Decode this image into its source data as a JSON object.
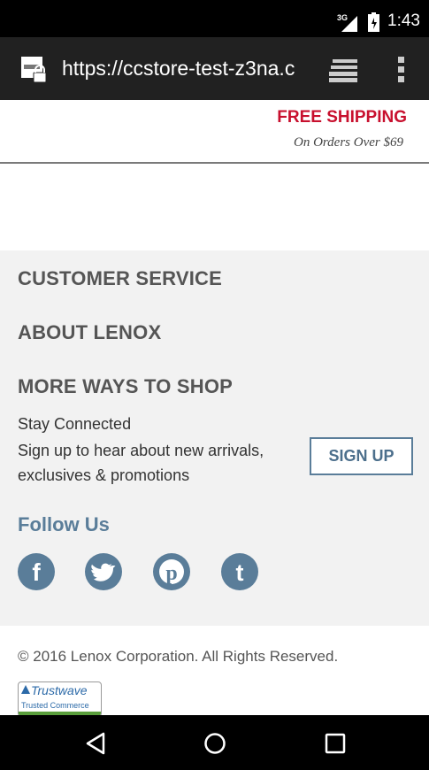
{
  "status_bar": {
    "network": "3G",
    "time": "1:43"
  },
  "browser": {
    "url": "https://ccstore-test-z3na.c"
  },
  "promo": {
    "headline": "FREE SHIPPING",
    "subtext": "On Orders Over $69"
  },
  "footer": {
    "links": [
      "CUSTOMER SERVICE",
      "ABOUT LENOX",
      "MORE WAYS TO SHOP"
    ],
    "stay_connected": "Stay Connected",
    "signup_text": "Sign up to hear about new arrivals, exclusives & promotions",
    "signup_button": "SIGN UP",
    "follow_us": "Follow Us",
    "social": [
      "facebook-icon",
      "twitter-icon",
      "pinterest-icon",
      "tumblr-icon"
    ],
    "copyright": "© 2016 Lenox Corporation. All Rights Reserved.",
    "trust_badge": {
      "title": "Trustwave",
      "subtitle": "Trusted Commerce"
    }
  },
  "colors": {
    "promo_red": "#c8102e",
    "accent_blue": "#5a7d99",
    "footer_bg": "#f2f2f2"
  }
}
